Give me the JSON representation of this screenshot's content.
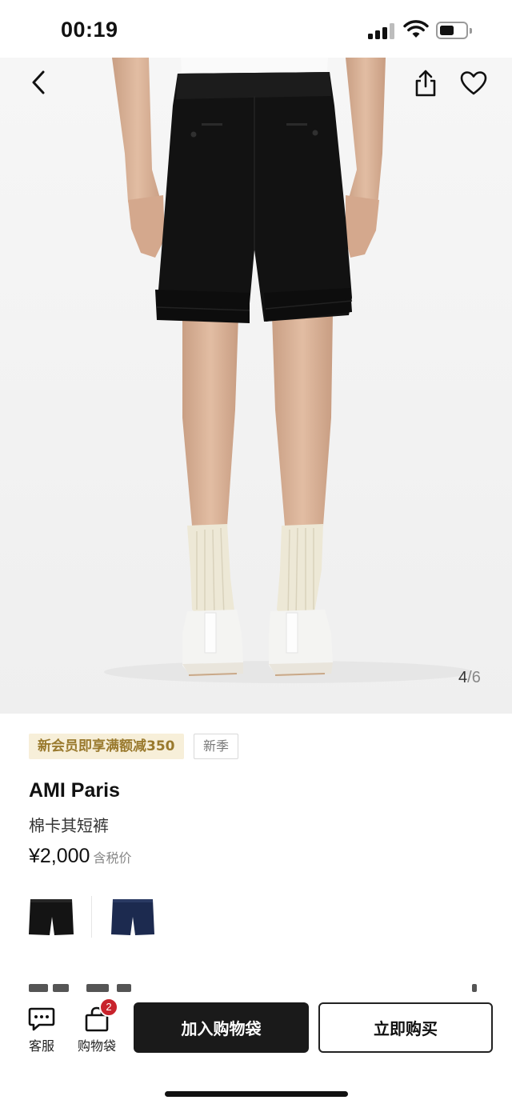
{
  "status_bar": {
    "time": "00:19"
  },
  "gallery": {
    "current": "4",
    "separator": "/",
    "total": "6"
  },
  "product": {
    "promo_tag": "新会员即享满额减350",
    "season_tag": "新季",
    "brand": "AMI Paris",
    "name": "棉卡其短裤",
    "price": "¥2,000",
    "tax_note": "含税价",
    "swatches": [
      {
        "color": "#141414"
      },
      {
        "color": "#1c2a4f"
      }
    ]
  },
  "bottom_bar": {
    "customer_service_label": "客服",
    "bag_label": "购物袋",
    "bag_count": "2",
    "add_to_bag_label": "加入购物袋",
    "buy_now_label": "立即购买"
  },
  "colors": {
    "promo_bg": "#f7efd9",
    "promo_text": "#9a7a2e",
    "badge": "#c8232c",
    "primary_button": "#1a1a1a"
  }
}
